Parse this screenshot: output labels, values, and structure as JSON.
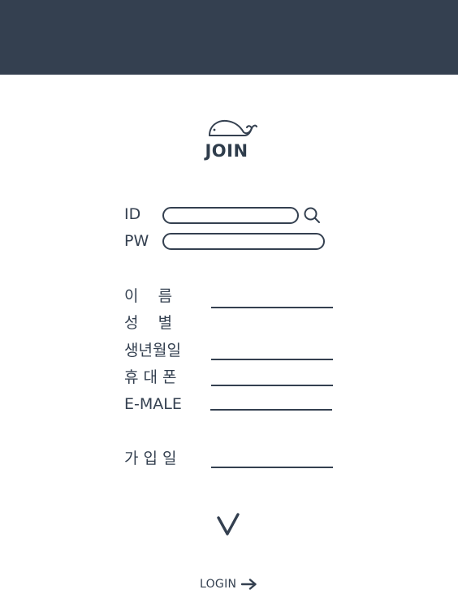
{
  "header": {
    "background_color": "#344050"
  },
  "brand": {
    "logo_icon": "whale-icon",
    "title": "JOIN"
  },
  "account": {
    "id_label": "ID",
    "id_value": "",
    "id_search_icon": "search-icon",
    "pw_label": "PW",
    "pw_value": ""
  },
  "profile": {
    "name_label": "이    름",
    "name_value": "",
    "gender_label": "성    별",
    "birthdate_label": "생년월일",
    "birthdate_value": "",
    "phone_label": "휴 대 폰",
    "phone_value": "",
    "email_label": "E-MALE",
    "email_value": "",
    "join_date_label": "가 입 일",
    "join_date_value": ""
  },
  "actions": {
    "submit_icon": "checkmark-icon",
    "login_label": "LOGIN",
    "login_icon": "arrow-right-icon"
  },
  "colors": {
    "primary": "#344050",
    "background": "#ffffff"
  }
}
